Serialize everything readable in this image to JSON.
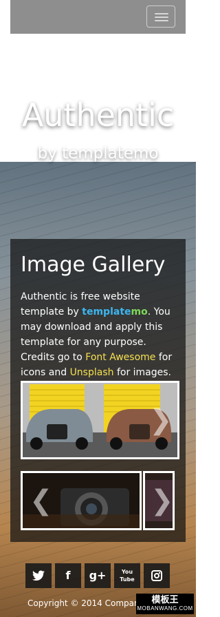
{
  "header": {
    "menu_button": "toggle-navigation"
  },
  "hero": {
    "title": "Authentic",
    "subtitle": "by templatemo"
  },
  "gallery": {
    "title": "Image Gallery",
    "text_1": "Authentic is free website template by ",
    "brand_a": "template",
    "brand_b": "mo",
    "text_2": ". You may download and apply this template for any purpose. Credits go to ",
    "link_font_awesome": "Font Awesome",
    "text_3": " for icons and ",
    "link_unsplash": "Unsplash",
    "text_4": " for images.",
    "next_arrow": "❯",
    "prev_arrow": "❮"
  },
  "social": {
    "items": [
      {
        "icon": "twitter-icon",
        "glyph": "🐦"
      },
      {
        "icon": "facebook-icon",
        "glyph": "f"
      },
      {
        "icon": "google-plus-icon",
        "glyph": "g+"
      },
      {
        "icon": "youtube-icon",
        "glyph": "You Tube"
      },
      {
        "icon": "instagram-icon",
        "glyph": "◙"
      }
    ]
  },
  "footer": {
    "copyright": "Copyright © 2014 Compan"
  },
  "watermark": {
    "line1": "模板王",
    "line2": "MOBANWANG.COM"
  },
  "colors": {
    "accent_blue": "#3cb6f0",
    "accent_green": "#7ed957",
    "link_yellow": "#f5e050",
    "panel_bg": "rgba(20,20,20,0.72)"
  }
}
